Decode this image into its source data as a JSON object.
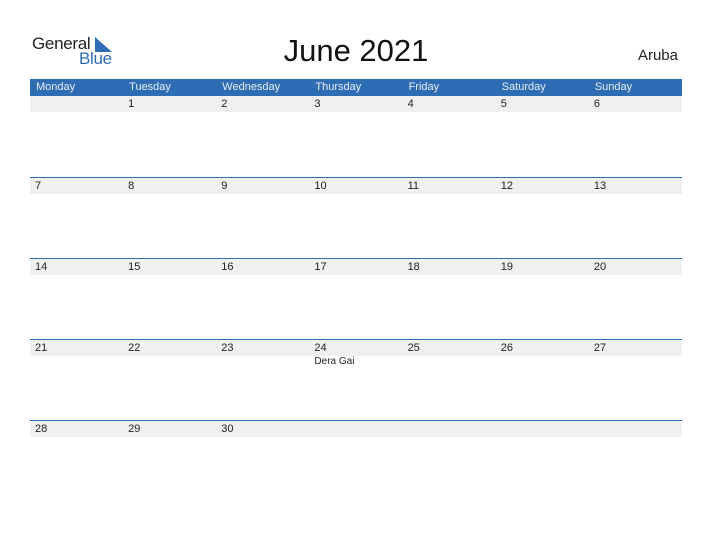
{
  "logo": {
    "word1": "General",
    "word2": "Blue"
  },
  "title": "June 2021",
  "country": "Aruba",
  "colors": {
    "accent": "#2E6DB3",
    "day_row_bg": "#F0F0F0"
  },
  "weekdays": [
    "Monday",
    "Tuesday",
    "Wednesday",
    "Thursday",
    "Friday",
    "Saturday",
    "Sunday"
  ],
  "weeks": [
    {
      "days": [
        "",
        "1",
        "2",
        "3",
        "4",
        "5",
        "6"
      ],
      "events": [
        "",
        "",
        "",
        "",
        "",
        "",
        ""
      ]
    },
    {
      "days": [
        "7",
        "8",
        "9",
        "10",
        "11",
        "12",
        "13"
      ],
      "events": [
        "",
        "",
        "",
        "",
        "",
        "",
        ""
      ]
    },
    {
      "days": [
        "14",
        "15",
        "16",
        "17",
        "18",
        "19",
        "20"
      ],
      "events": [
        "",
        "",
        "",
        "",
        "",
        "",
        ""
      ]
    },
    {
      "days": [
        "21",
        "22",
        "23",
        "24",
        "25",
        "26",
        "27"
      ],
      "events": [
        "",
        "",
        "",
        "Dera Gai",
        "",
        "",
        ""
      ]
    },
    {
      "days": [
        "28",
        "29",
        "30",
        "",
        "",
        "",
        ""
      ],
      "events": [
        "",
        "",
        "",
        "",
        "",
        "",
        ""
      ]
    }
  ]
}
